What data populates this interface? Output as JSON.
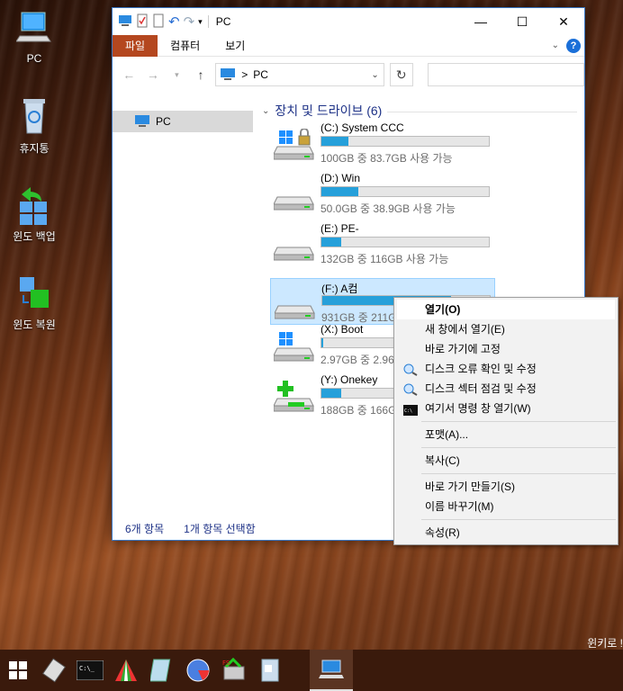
{
  "desktop": {
    "icons": [
      {
        "label": "PC",
        "icon": "pc-icon"
      },
      {
        "label": "휴지통",
        "icon": "recycle-bin-icon"
      },
      {
        "label": "윈도 백업",
        "icon": "backup-icon"
      },
      {
        "label": "윈도 복원",
        "icon": "restore-icon"
      }
    ],
    "watermark": "윈키로 !"
  },
  "window": {
    "title": "PC",
    "ribbon_tabs": [
      "파일",
      "컴퓨터",
      "보기"
    ],
    "address": "PC",
    "address_sep": ">",
    "nav": {
      "selected": "PC"
    },
    "section": {
      "title": "장치 및 드라이브 (6)"
    },
    "drives": [
      {
        "name": "(C:) System CCC",
        "space": "100GB 중 83.7GB 사용 가능",
        "used_fraction": 0.16,
        "icon": "windows-drive-lock-icon"
      },
      {
        "name": "(D:) Win",
        "space": "50.0GB 중 38.9GB 사용 가능",
        "used_fraction": 0.22,
        "icon": "drive-icon"
      },
      {
        "name": "(E:) PE-",
        "space": "132GB 중 116GB 사용 가능",
        "used_fraction": 0.12,
        "icon": "drive-icon"
      },
      {
        "name": "(F:) A컴",
        "space": "931GB 중 211G",
        "used_fraction": 0.77,
        "icon": "drive-icon",
        "selected": true
      },
      {
        "name": "(X:) Boot",
        "space": "2.97GB 중 2.96",
        "used_fraction": 0.01,
        "icon": "windows-drive-icon"
      },
      {
        "name": "(Y:) Onekey",
        "space": "188GB 중 166G",
        "used_fraction": 0.12,
        "icon": "plus-drive-icon"
      }
    ],
    "status": {
      "count": "6개 항목",
      "selected": "1개 항목 선택함"
    }
  },
  "context_menu": {
    "items": [
      {
        "label": "열기(O)",
        "bold": true
      },
      {
        "label": "새 창에서 열기(E)"
      },
      {
        "label": "바로 가기에 고정"
      },
      {
        "label": "디스크 오류 확인 및 수정",
        "icon": "disk-check-icon"
      },
      {
        "label": "디스크 섹터 점검 및 수정",
        "icon": "disk-check-icon"
      },
      {
        "label": "여기서 명령 창 열기(W)",
        "icon": "cmd-icon"
      },
      {
        "sep": true
      },
      {
        "label": "포맷(A)..."
      },
      {
        "sep": true
      },
      {
        "label": "복사(C)"
      },
      {
        "sep": true
      },
      {
        "label": "바로 가기 만들기(S)"
      },
      {
        "label": "이름 바꾸기(M)"
      },
      {
        "sep": true
      },
      {
        "label": "속성(R)"
      }
    ]
  },
  "taskbar": {
    "items": [
      "start-icon",
      "tool-icon",
      "cmd-icon",
      "partition-icon",
      "notepad-icon",
      "disk-icon",
      "sync-icon",
      "file-icon",
      "explorer-icon"
    ]
  }
}
